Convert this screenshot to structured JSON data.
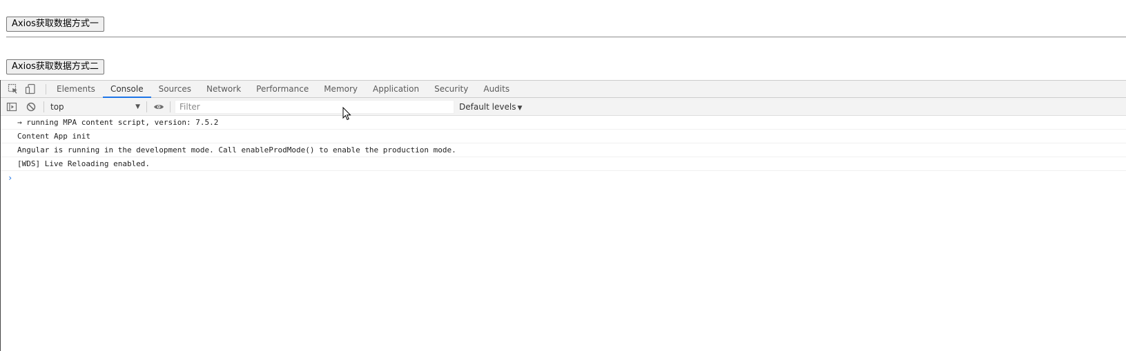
{
  "page": {
    "button1_label": "Axios获取数据方式一",
    "button2_label": "Axios获取数据方式二"
  },
  "devtools": {
    "tabs": [
      {
        "label": "Elements"
      },
      {
        "label": "Console",
        "active": true
      },
      {
        "label": "Sources"
      },
      {
        "label": "Network"
      },
      {
        "label": "Performance"
      },
      {
        "label": "Memory"
      },
      {
        "label": "Application"
      },
      {
        "label": "Security"
      },
      {
        "label": "Audits"
      }
    ],
    "console": {
      "context": "top",
      "filter_placeholder": "Filter",
      "filter_value": "",
      "levels_label": "Default levels",
      "messages": [
        "→ running MPA content script, version: 7.5.2",
        "Content App init",
        "Angular is running in the development mode. Call enableProdMode() to enable the production mode.",
        "[WDS] Live Reloading enabled."
      ],
      "prompt": "›"
    }
  },
  "colors": {
    "accent": "#1a73e8",
    "toolbar_bg": "#f3f3f3"
  }
}
